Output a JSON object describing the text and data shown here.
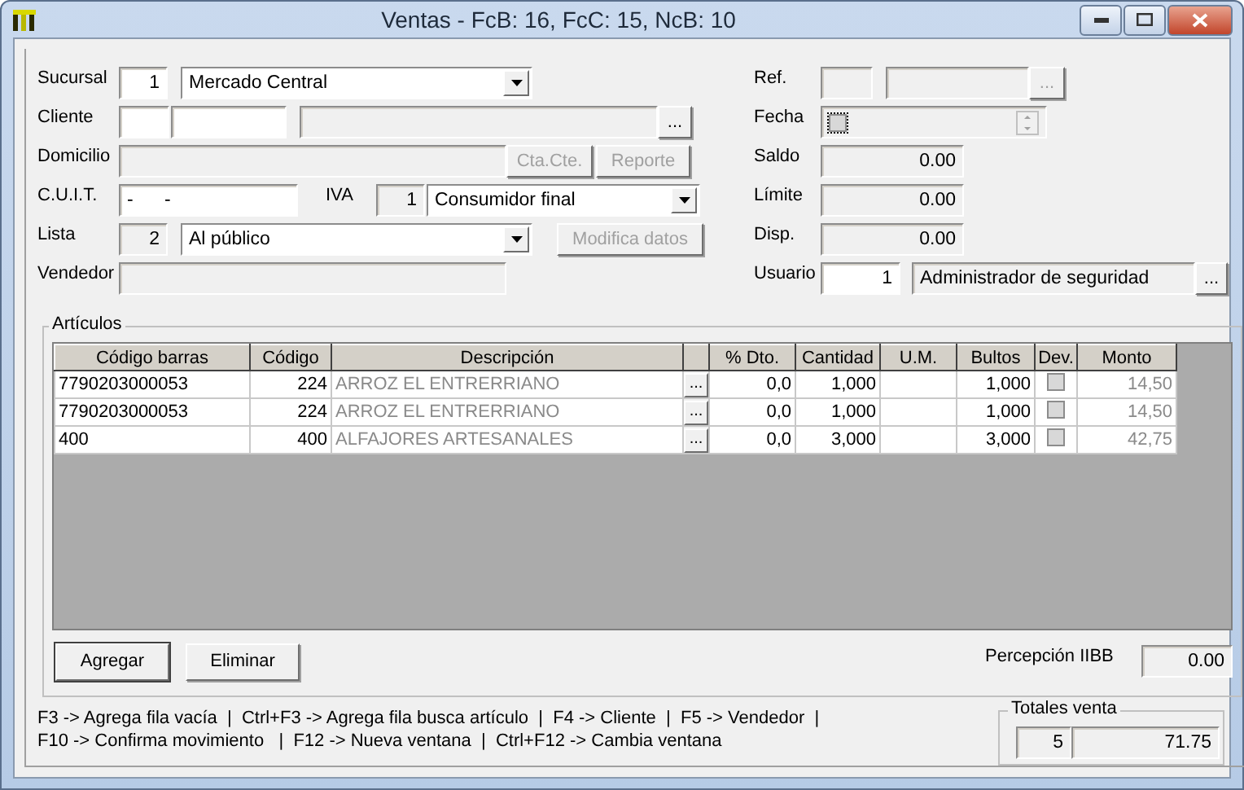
{
  "window": {
    "title": "Ventas - FcB: 16, FcC: 15, NcB: 10"
  },
  "sucursal": {
    "label": "Sucursal",
    "code": {
      "value": "1",
      "disabled": false
    },
    "combo": {
      "value": "Mercado Central"
    }
  },
  "cliente": {
    "label": "Cliente",
    "code": {
      "disabled": false
    },
    "number": {
      "disabled": false
    },
    "name": {
      "disabled": true
    },
    "browse": {
      "label": "...",
      "disabled": false
    }
  },
  "domicilio": {
    "label": "Domicilio",
    "field": {
      "disabled": true
    },
    "buttons": [
      {
        "label": "Cta.Cte.",
        "disabled": true
      },
      {
        "label": "Reporte",
        "disabled": true
      }
    ]
  },
  "cuit": {
    "label": "C.U.I.T.",
    "field": {
      "value": "-      -",
      "disabled": false
    }
  },
  "iva": {
    "label": "IVA",
    "code": {
      "value": "1",
      "disabled": true
    },
    "combo": {
      "value": "Consumidor final"
    }
  },
  "lista": {
    "label": "Lista",
    "code": {
      "value": "2",
      "disabled": true
    },
    "combo": {
      "value": "Al público"
    },
    "button": {
      "label": "Modifica datos",
      "disabled": true
    }
  },
  "vendedor": {
    "label": "Vendedor",
    "field": {
      "disabled": true
    }
  },
  "ref": {
    "label": "Ref.",
    "code": {
      "disabled": true
    },
    "name": {
      "disabled": true
    },
    "browse": {
      "label": "...",
      "disabled": true
    }
  },
  "fecha": {
    "label": "Fecha",
    "checked": false
  },
  "saldo": {
    "label": "Saldo",
    "field": {
      "value": "0.00",
      "disabled": true
    }
  },
  "limite": {
    "label": "Límite",
    "field": {
      "value": "0.00",
      "disabled": true
    }
  },
  "disp": {
    "label": "Disp.",
    "field": {
      "value": "0.00",
      "disabled": true
    }
  },
  "usuario": {
    "label": "Usuario",
    "code": {
      "value": "1",
      "disabled": false
    },
    "name": {
      "value": "Administrador de seguridad",
      "disabled": true
    },
    "browse": {
      "label": "...",
      "disabled": false
    }
  },
  "articulos": {
    "title": "Artículos",
    "columns": [
      "Código barras",
      "Código",
      "Descripción",
      "",
      "% Dto.",
      "Cantidad",
      "U.M.",
      "Bultos",
      "Dev.",
      "Monto"
    ],
    "rows": [
      {
        "barcode": "7790203000053",
        "code": "224",
        "description": "ARROZ EL ENTRERRIANO",
        "browse": "...",
        "discount": "0,0",
        "quantity": "1,000",
        "bundles": "1,000",
        "returned": false,
        "amount": "14,50"
      },
      {
        "barcode": "7790203000053",
        "code": "224",
        "description": "ARROZ EL ENTRERRIANO",
        "browse": "...",
        "discount": "0,0",
        "quantity": "1,000",
        "bundles": "1,000",
        "returned": false,
        "amount": "14,50"
      },
      {
        "barcode": "400",
        "code": "400",
        "description": "ALFAJORES ARTESANALES",
        "browse": "...",
        "discount": "0,0",
        "quantity": "3,000",
        "bundles": "3,000",
        "returned": false,
        "amount": "42,75"
      }
    ],
    "buttons": [
      "Agregar",
      "Eliminar"
    ],
    "perception": {
      "label": "Percepción IIBB",
      "value": "0.00"
    }
  },
  "shortcuts": [
    "F3 -> Agrega fila vacía  |  Ctrl+F3 -> Agrega fila busca artículo  |  F4 -> Cliente  |  F5 -> Vendedor  |",
    "F10 -> Confirma movimiento   |  F12 -> Nueva ventana  |  Ctrl+F12 -> Cambia ventana"
  ],
  "totals": {
    "title": "Totales venta",
    "count": "5",
    "amount": "71.75"
  }
}
